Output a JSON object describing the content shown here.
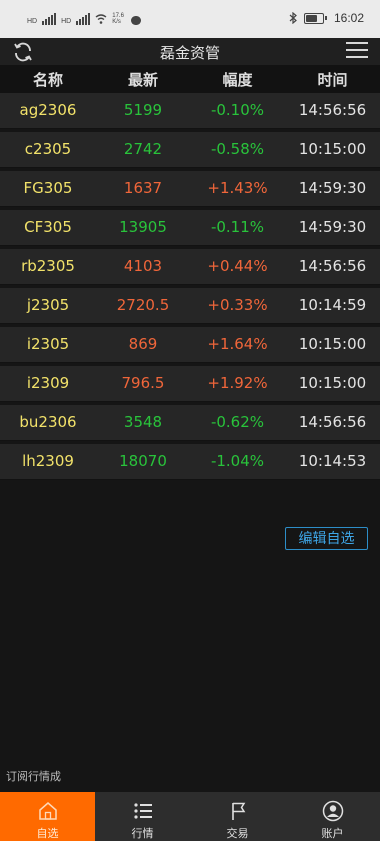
{
  "status_bar": {
    "sim1": "HD",
    "sim2": "HD",
    "net_speed": "17.6 K/s",
    "time": "16:02",
    "battery_level": 0.75
  },
  "header": {
    "title": "磊金资管",
    "icons": {
      "left": "refresh-icon",
      "right": "menu-icon"
    }
  },
  "columns": [
    "名称",
    "最新",
    "幅度",
    "时间"
  ],
  "rows": [
    {
      "code": "ag2306",
      "price": "5199",
      "change": "-0.10%",
      "time": "14:56:56",
      "direction": "down"
    },
    {
      "code": "c2305",
      "price": "2742",
      "change": "-0.58%",
      "time": "10:15:00",
      "direction": "down"
    },
    {
      "code": "FG305",
      "price": "1637",
      "change": "+1.43%",
      "time": "14:59:30",
      "direction": "up"
    },
    {
      "code": "CF305",
      "price": "13905",
      "change": "-0.11%",
      "time": "14:59:30",
      "direction": "down"
    },
    {
      "code": "rb2305",
      "price": "4103",
      "change": "+0.44%",
      "time": "14:56:56",
      "direction": "up"
    },
    {
      "code": "j2305",
      "price": "2720.5",
      "change": "+0.33%",
      "time": "10:14:59",
      "direction": "up"
    },
    {
      "code": "i2305",
      "price": "869",
      "change": "+1.64%",
      "time": "10:15:00",
      "direction": "up"
    },
    {
      "code": "i2309",
      "price": "796.5",
      "change": "+1.92%",
      "time": "10:15:00",
      "direction": "up"
    },
    {
      "code": "bu2306",
      "price": "3548",
      "change": "-0.62%",
      "time": "14:56:56",
      "direction": "down"
    },
    {
      "code": "lh2309",
      "price": "18070",
      "change": "-1.04%",
      "time": "10:14:53",
      "direction": "down"
    }
  ],
  "edit_button": "编辑自选",
  "footer_note": "订阅行情成",
  "bottom_nav": [
    {
      "label": "自选",
      "icon": "home-icon",
      "active": true
    },
    {
      "label": "行情",
      "icon": "list-icon",
      "active": false
    },
    {
      "label": "交易",
      "icon": "flag-icon",
      "active": false
    },
    {
      "label": "账户",
      "icon": "account-icon",
      "active": false
    }
  ],
  "colors": {
    "up": "#f0663a",
    "down": "#29c33b",
    "code": "#f2e26a",
    "accent": "#ff6a00",
    "edit_border": "#2d8ec8"
  }
}
